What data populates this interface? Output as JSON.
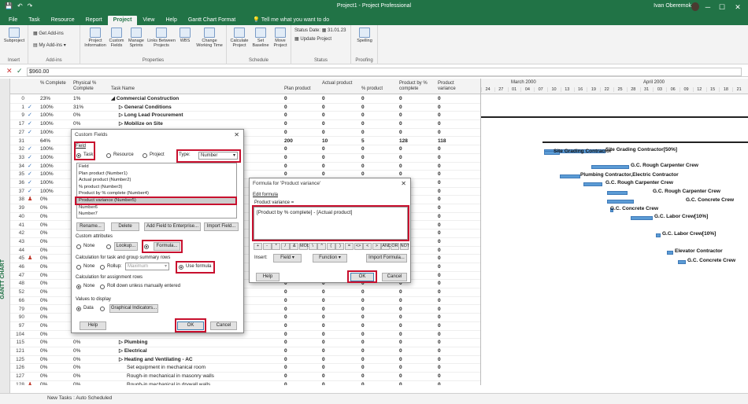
{
  "title": "Project1 - Project Professional",
  "user": "Ivan Oberemok",
  "menu": [
    "File",
    "Task",
    "Resource",
    "Report",
    "Project",
    "View",
    "Help",
    "Gantt Chart Format"
  ],
  "tell_me": "Tell me what you want to do",
  "ribbon": {
    "insert_label": "Insert",
    "subproject": "Subproject",
    "addins_label": "Add-ins",
    "get_addins": "Get Add-ins",
    "my_addins": "My Add-ins",
    "properties_label": "Properties",
    "project_info": "Project Information",
    "custom_fields": "Custom Fields",
    "manage_sprints": "Manage Sprints",
    "links_between": "Links Between Projects",
    "wbs": "WBS",
    "change_working_time": "Change Working Time",
    "schedule_label": "Schedule",
    "calculate_project": "Calculate Project",
    "set_baseline": "Set Baseline",
    "move_project": "Move Project",
    "status_label": "Status",
    "status_date": "Status Date:",
    "status_date_value": "31.01.23",
    "update_project": "Update Project",
    "proofing_label": "Proofing",
    "spelling": "Spelling"
  },
  "formula_bar": {
    "value": "$960.00"
  },
  "sidebar_label": "GANTT CHART",
  "grid": {
    "headers": {
      "pc": "% Complete",
      "ppc": "Physical % Complete",
      "task": "Task Name",
      "v1": "Plan product",
      "v2": "Actual product",
      "v3": "% product",
      "v4": "Product by % complete",
      "v5": "Product variance"
    },
    "rows": [
      {
        "id": "0",
        "ind": "",
        "pc": "23%",
        "ppc": "1%",
        "name": "Commercial Construction",
        "lvl": 0,
        "bold": true,
        "v": [
          "0",
          "0",
          "0",
          "0",
          "0"
        ]
      },
      {
        "id": "1",
        "ind": "✓",
        "pc": "100%",
        "ppc": "31%",
        "name": "General Conditions",
        "lvl": 1,
        "bold": true,
        "v": [
          "0",
          "0",
          "0",
          "0",
          "0"
        ]
      },
      {
        "id": "9",
        "ind": "✓",
        "pc": "100%",
        "ppc": "0%",
        "name": "Long Lead Procurement",
        "lvl": 1,
        "bold": true,
        "v": [
          "0",
          "0",
          "0",
          "0",
          "0"
        ]
      },
      {
        "id": "17",
        "ind": "✓",
        "pc": "100%",
        "ppc": "0%",
        "name": "Mobilize on Site",
        "lvl": 1,
        "bold": true,
        "v": [
          "0",
          "0",
          "0",
          "0",
          "0"
        ]
      },
      {
        "id": "27",
        "ind": "✓",
        "pc": "100%",
        "ppc": "",
        "name": "",
        "lvl": 1,
        "bold": true,
        "v": [
          "0",
          "0",
          "0",
          "0",
          "0"
        ]
      },
      {
        "id": "31",
        "ind": "",
        "pc": "64%",
        "ppc": "",
        "name": "",
        "lvl": 1,
        "bold": true,
        "v": [
          "200",
          "10",
          "5",
          "128",
          "118"
        ]
      },
      {
        "id": "32",
        "ind": "✓",
        "pc": "100%",
        "ppc": "",
        "name": "",
        "lvl": 2,
        "bold": false,
        "v": [
          "0",
          "0",
          "0",
          "0",
          "0"
        ]
      },
      {
        "id": "33",
        "ind": "✓",
        "pc": "100%",
        "ppc": "",
        "name": "",
        "lvl": 2,
        "bold": false,
        "v": [
          "0",
          "0",
          "0",
          "0",
          "0"
        ]
      },
      {
        "id": "34",
        "ind": "✓",
        "pc": "100%",
        "ppc": "",
        "name": "",
        "lvl": 2,
        "bold": false,
        "v": [
          "0",
          "0",
          "0",
          "0",
          "0"
        ]
      },
      {
        "id": "35",
        "ind": "✓",
        "pc": "100%",
        "ppc": "",
        "name": "",
        "lvl": 2,
        "bold": false,
        "v": [
          "0",
          "0",
          "0",
          "0",
          "0"
        ]
      },
      {
        "id": "36",
        "ind": "✓",
        "pc": "100%",
        "ppc": "",
        "name": "",
        "lvl": 2,
        "bold": false,
        "v": [
          "0",
          "0",
          "0",
          "0",
          "0"
        ]
      },
      {
        "id": "37",
        "ind": "✓",
        "pc": "100%",
        "ppc": "",
        "name": "",
        "lvl": 2,
        "bold": false,
        "v": [
          "0",
          "0",
          "0",
          "0",
          "0"
        ]
      },
      {
        "id": "38",
        "ind": "red",
        "pc": "0%",
        "ppc": "",
        "name": "",
        "lvl": 2,
        "bold": false,
        "v": [
          "0",
          "0",
          "0",
          "0",
          "0"
        ]
      },
      {
        "id": "39",
        "ind": "",
        "pc": "0%",
        "ppc": "",
        "name": "",
        "lvl": 2,
        "bold": false,
        "v": [
          "0",
          "0",
          "0",
          "0",
          "0"
        ]
      },
      {
        "id": "40",
        "ind": "",
        "pc": "0%",
        "ppc": "",
        "name": "",
        "lvl": 2,
        "bold": false,
        "v": [
          "0",
          "0",
          "0",
          "0",
          "0"
        ]
      },
      {
        "id": "41",
        "ind": "",
        "pc": "0%",
        "ppc": "",
        "name": "",
        "lvl": 2,
        "bold": false,
        "v": [
          "0",
          "0",
          "0",
          "0",
          "0"
        ]
      },
      {
        "id": "42",
        "ind": "",
        "pc": "0%",
        "ppc": "",
        "name": "",
        "lvl": 2,
        "bold": false,
        "v": [
          "0",
          "0",
          "0",
          "0",
          "0"
        ]
      },
      {
        "id": "43",
        "ind": "",
        "pc": "0%",
        "ppc": "",
        "name": "",
        "lvl": 2,
        "bold": false,
        "v": [
          "0",
          "0",
          "0",
          "0",
          "0"
        ]
      },
      {
        "id": "44",
        "ind": "",
        "pc": "0%",
        "ppc": "",
        "name": "",
        "lvl": 2,
        "bold": false,
        "v": [
          "0",
          "0",
          "0",
          "0",
          "0"
        ]
      },
      {
        "id": "45",
        "ind": "red",
        "pc": "0%",
        "ppc": "",
        "name": "",
        "lvl": 2,
        "bold": false,
        "v": [
          "0",
          "0",
          "0",
          "0",
          "0"
        ]
      },
      {
        "id": "46",
        "ind": "",
        "pc": "0%",
        "ppc": "",
        "name": "",
        "lvl": 2,
        "bold": false,
        "v": [
          "0",
          "0",
          "0",
          "0",
          "0"
        ]
      },
      {
        "id": "47",
        "ind": "",
        "pc": "0%",
        "ppc": "",
        "name": "",
        "lvl": 2,
        "bold": false,
        "v": [
          "0",
          "0",
          "0",
          "0",
          "0"
        ]
      },
      {
        "id": "48",
        "ind": "",
        "pc": "0%",
        "ppc": "",
        "name": "",
        "lvl": 2,
        "bold": false,
        "v": [
          "0",
          "0",
          "0",
          "0",
          "0"
        ]
      },
      {
        "id": "52",
        "ind": "",
        "pc": "0%",
        "ppc": "",
        "name": "",
        "lvl": 2,
        "bold": false,
        "v": [
          "0",
          "0",
          "0",
          "0",
          "0"
        ]
      },
      {
        "id": "66",
        "ind": "",
        "pc": "0%",
        "ppc": "",
        "name": "",
        "lvl": 2,
        "bold": false,
        "v": [
          "0",
          "0",
          "0",
          "0",
          "0"
        ]
      },
      {
        "id": "79",
        "ind": "",
        "pc": "0%",
        "ppc": "",
        "name": "",
        "lvl": 2,
        "bold": false,
        "v": [
          "0",
          "0",
          "0",
          "0",
          "0"
        ]
      },
      {
        "id": "90",
        "ind": "",
        "pc": "0%",
        "ppc": "",
        "name": "",
        "lvl": 2,
        "bold": false,
        "v": [
          "0",
          "0",
          "0",
          "0",
          "0"
        ]
      },
      {
        "id": "97",
        "ind": "",
        "pc": "0%",
        "ppc": "",
        "name": "",
        "lvl": 2,
        "bold": false,
        "v": [
          "0",
          "0",
          "0",
          "0",
          "0"
        ]
      },
      {
        "id": "104",
        "ind": "",
        "pc": "0%",
        "ppc": "",
        "name": "",
        "lvl": 2,
        "bold": false,
        "v": [
          "0",
          "0",
          "0",
          "0",
          "0"
        ]
      },
      {
        "id": "115",
        "ind": "",
        "pc": "0%",
        "ppc": "0%",
        "name": "Plumbing",
        "lvl": 1,
        "bold": true,
        "v": [
          "0",
          "0",
          "0",
          "0",
          "0"
        ]
      },
      {
        "id": "121",
        "ind": "",
        "pc": "0%",
        "ppc": "0%",
        "name": "Electrical",
        "lvl": 1,
        "bold": true,
        "v": [
          "0",
          "0",
          "0",
          "0",
          "0"
        ]
      },
      {
        "id": "125",
        "ind": "",
        "pc": "0%",
        "ppc": "0%",
        "name": "Heating and Ventilating - AC",
        "lvl": 1,
        "bold": true,
        "v": [
          "0",
          "0",
          "0",
          "0",
          "0"
        ]
      },
      {
        "id": "126",
        "ind": "",
        "pc": "0%",
        "ppc": "0%",
        "name": "Set equipment in mechanical room",
        "lvl": 2,
        "bold": false,
        "v": [
          "0",
          "0",
          "0",
          "0",
          "0"
        ]
      },
      {
        "id": "127",
        "ind": "",
        "pc": "0%",
        "ppc": "0%",
        "name": "Rough-in mechanical in masonry walls",
        "lvl": 2,
        "bold": false,
        "v": [
          "0",
          "0",
          "0",
          "0",
          "0"
        ]
      },
      {
        "id": "128",
        "ind": "red",
        "pc": "0%",
        "ppc": "0%",
        "name": "Rough-in mechanical in drywall walls",
        "lvl": 2,
        "bold": false,
        "v": [
          "0",
          "0",
          "0",
          "0",
          "0"
        ]
      },
      {
        "id": "129",
        "ind": "red",
        "pc": "0%",
        "ppc": "0%",
        "name": "Install duct in building shoes",
        "lvl": 2,
        "bold": false,
        "v": [
          "0",
          "0",
          "0",
          "0",
          "0"
        ]
      }
    ]
  },
  "gantt": {
    "months": [
      "March 2000",
      "April 2000"
    ],
    "days": [
      "24",
      "27",
      "01",
      "04",
      "07",
      "10",
      "13",
      "16",
      "19",
      "22",
      "25",
      "28",
      "31",
      "03",
      "06",
      "09",
      "12",
      "15",
      "18",
      "21"
    ],
    "labels": [
      "Site Grading Contractor[50%]",
      "Site Grading Contractor",
      "G.C. Rough Carpenter Crew",
      "Plumbing Contractor,Electric Contractor",
      "G.C. Rough Carpenter Crew",
      "G.C. Rough Carpenter Crew",
      "G.C. Concrete Crew",
      "G.C. Concrete Crew",
      "G.C. Labor Crew[10%]",
      "G.C. Labor Crew[10%]",
      "Elevator Contractor",
      "G.C. Concrete Crew"
    ]
  },
  "custom_fields": {
    "title": "Custom Fields",
    "field_label": "Field",
    "task": "Task",
    "resource": "Resource",
    "project": "Project",
    "type_label": "Type:",
    "type_value": "Number",
    "list": [
      "Field",
      "Plan product (Number1)",
      "Actual product (Number2)",
      "% product (Number3)",
      "Product by % complete (Number4)",
      "Product variance (Number5)",
      "Number6",
      "Number7"
    ],
    "rename": "Rename...",
    "delete": "Delete",
    "add_enterprise": "Add Field to Enterprise...",
    "import_field": "Import Field...",
    "custom_attributes": "Custom attributes",
    "none": "None",
    "lookup": "Lookup...",
    "formula": "Formula...",
    "calc_rows": "Calculation for task and group summary rows",
    "rollup": "Rollup:",
    "rollup_value": "Maximum",
    "use_formula": "Use formula",
    "calc_assign": "Calculation for assignment rows",
    "roll_down": "Roll down unless manually entered",
    "values_display": "Values to display",
    "data": "Data",
    "graphical": "Graphical Indicators...",
    "help": "Help",
    "ok": "OK",
    "cancel": "Cancel"
  },
  "formula_dialog": {
    "title": "Formula for 'Product variance'",
    "edit_formula": "Edit formula",
    "field_eq": "Product variance =",
    "expression": "[Product by % complete] - [Actual product]",
    "ops": [
      "+",
      "-",
      "*",
      "/",
      "&",
      "MOD",
      "\\",
      "^",
      "(",
      ")",
      "=",
      "<>",
      "<",
      ">",
      "AND",
      "OR",
      "NOT"
    ],
    "insert": "Insert:",
    "field": "Field",
    "function": "Function",
    "import_formula": "Import Formula...",
    "help": "Help",
    "ok": "OK",
    "cancel": "Cancel"
  },
  "status_bar": "New Tasks : Auto Scheduled"
}
